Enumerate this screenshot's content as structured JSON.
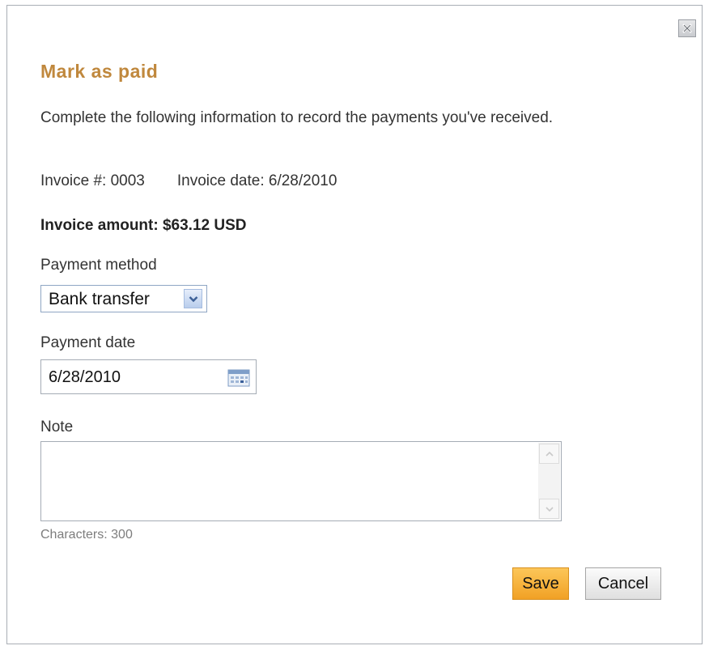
{
  "dialog": {
    "title": "Mark as paid",
    "intro": "Complete the following information to record the payments you've received.",
    "close_icon": "close-icon"
  },
  "invoice": {
    "number_text": "Invoice #: 0003",
    "date_text": "Invoice date: 6/28/2010",
    "amount_text": "Invoice amount: $63.12 USD"
  },
  "payment_method": {
    "label": "Payment method",
    "selected": "Bank transfer",
    "icon": "chevron-down-icon"
  },
  "payment_date": {
    "label": "Payment date",
    "value": "6/28/2010",
    "icon": "calendar-icon"
  },
  "note": {
    "label": "Note",
    "value": "",
    "char_count": "Characters: 300"
  },
  "actions": {
    "save_label": "Save",
    "cancel_label": "Cancel"
  },
  "colors": {
    "title": "#c0883d",
    "save_button": "#f1a125",
    "border": "#a9aeb5"
  }
}
